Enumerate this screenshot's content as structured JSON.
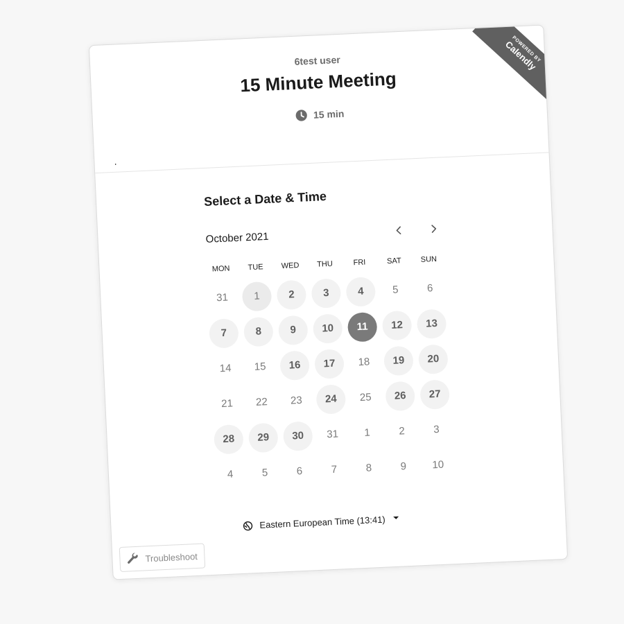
{
  "ribbon": {
    "powered_by": "POWERED BY",
    "brand": "Calendly"
  },
  "header": {
    "owner": "6test user",
    "title": "15 Minute Meeting",
    "duration": "15 min",
    "note": "."
  },
  "scheduler": {
    "title": "Select a Date & Time",
    "month": "October 2021",
    "weekdays": [
      "MON",
      "TUE",
      "WED",
      "THU",
      "FRI",
      "SAT",
      "SUN"
    ],
    "days": [
      {
        "label": "31",
        "state": "disabled"
      },
      {
        "label": "1",
        "state": "today"
      },
      {
        "label": "2",
        "state": "available"
      },
      {
        "label": "3",
        "state": "available"
      },
      {
        "label": "4",
        "state": "available"
      },
      {
        "label": "5",
        "state": "disabled"
      },
      {
        "label": "6",
        "state": "disabled"
      },
      {
        "label": "7",
        "state": "available"
      },
      {
        "label": "8",
        "state": "available"
      },
      {
        "label": "9",
        "state": "available"
      },
      {
        "label": "10",
        "state": "available"
      },
      {
        "label": "11",
        "state": "selected"
      },
      {
        "label": "12",
        "state": "available"
      },
      {
        "label": "13",
        "state": "available"
      },
      {
        "label": "14",
        "state": "disabled"
      },
      {
        "label": "15",
        "state": "disabled"
      },
      {
        "label": "16",
        "state": "available"
      },
      {
        "label": "17",
        "state": "available"
      },
      {
        "label": "18",
        "state": "disabled"
      },
      {
        "label": "19",
        "state": "available"
      },
      {
        "label": "20",
        "state": "available"
      },
      {
        "label": "21",
        "state": "disabled"
      },
      {
        "label": "22",
        "state": "disabled"
      },
      {
        "label": "23",
        "state": "disabled"
      },
      {
        "label": "24",
        "state": "available"
      },
      {
        "label": "25",
        "state": "disabled"
      },
      {
        "label": "26",
        "state": "available"
      },
      {
        "label": "27",
        "state": "available"
      },
      {
        "label": "28",
        "state": "available"
      },
      {
        "label": "29",
        "state": "available"
      },
      {
        "label": "30",
        "state": "available"
      },
      {
        "label": "31",
        "state": "disabled"
      },
      {
        "label": "1",
        "state": "disabled"
      },
      {
        "label": "2",
        "state": "disabled"
      },
      {
        "label": "3",
        "state": "disabled"
      },
      {
        "label": "4",
        "state": "disabled"
      },
      {
        "label": "5",
        "state": "disabled"
      },
      {
        "label": "6",
        "state": "disabled"
      },
      {
        "label": "7",
        "state": "disabled"
      },
      {
        "label": "8",
        "state": "disabled"
      },
      {
        "label": "9",
        "state": "disabled"
      },
      {
        "label": "10",
        "state": "disabled"
      }
    ],
    "timezone": "Eastern European Time (13:41)"
  },
  "footer": {
    "troubleshoot_label": "Troubleshoot"
  },
  "colors": {
    "ribbon": "#606060",
    "selected_day": "#7a7a7a",
    "available_day": "#f2f2f2"
  },
  "icons": {
    "clock": "clock-icon",
    "prev": "chevron-left-icon",
    "next": "chevron-right-icon",
    "globe": "globe-icon",
    "wrench": "wrench-icon"
  }
}
